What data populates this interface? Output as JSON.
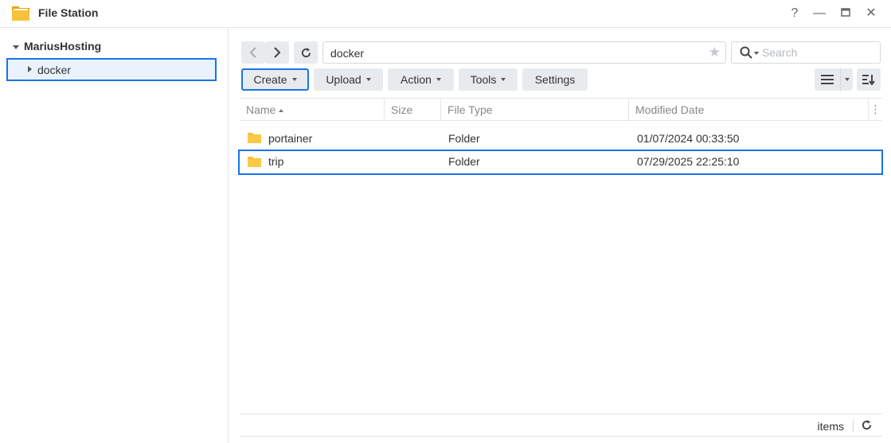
{
  "window": {
    "title": "File Station",
    "controls": [
      "?",
      "—",
      "□",
      "✕"
    ]
  },
  "sidebar": {
    "root_label": "MariusHosting",
    "items": [
      {
        "label": "docker"
      }
    ]
  },
  "toolbar": {
    "path": "docker",
    "search_placeholder": "Search",
    "buttons": {
      "create": "Create",
      "upload": "Upload",
      "action": "Action",
      "tools": "Tools",
      "settings": "Settings"
    }
  },
  "table": {
    "columns": {
      "name": "Name",
      "size": "Size",
      "file_type": "File Type",
      "modified": "Modified Date"
    },
    "rows": [
      {
        "name": "portainer",
        "size": "",
        "file_type": "Folder",
        "modified": "01/07/2024 00:33:50"
      },
      {
        "name": "trip",
        "size": "",
        "file_type": "Folder",
        "modified": "07/29/2025 22:25:10"
      }
    ]
  },
  "footer": {
    "items_label": "items"
  },
  "colors": {
    "accent": "#1a73e8",
    "button_bg": "#e8ebee",
    "folder": "#f8c23c"
  }
}
